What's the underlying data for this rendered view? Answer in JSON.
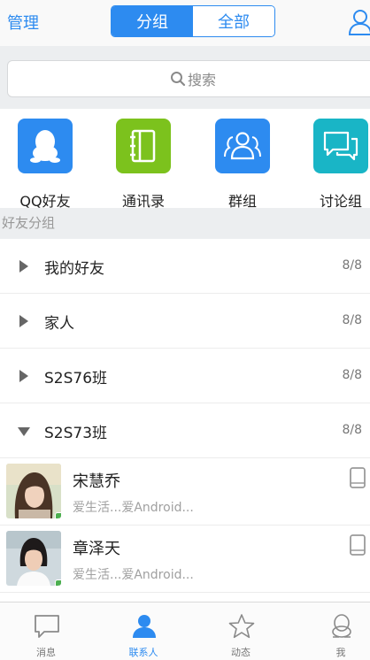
{
  "header": {
    "manage_label": "管理",
    "segments": [
      {
        "label": "分组",
        "active": true
      },
      {
        "label": "全部",
        "active": false
      }
    ]
  },
  "search": {
    "placeholder": "搜索"
  },
  "quick_entries": [
    {
      "label": "QQ好友",
      "icon": "qq-penguin-icon",
      "color": "#2d8bf0"
    },
    {
      "label": "通讯录",
      "icon": "contacts-book-icon",
      "color": "#7cc21d"
    },
    {
      "label": "群组",
      "icon": "group-people-icon",
      "color": "#2d8bf0"
    },
    {
      "label": "讨论组",
      "icon": "chat-bubbles-icon",
      "color": "#19b5c6"
    }
  ],
  "section_title": "好友分组",
  "groups": [
    {
      "name": "我的好友",
      "count": "8/8",
      "expanded": false
    },
    {
      "name": "家人",
      "count": "8/8",
      "expanded": false
    },
    {
      "name": "S2S76班",
      "count": "8/8",
      "expanded": false
    },
    {
      "name": "S2S73班",
      "count": "8/8",
      "expanded": true
    }
  ],
  "friends": [
    {
      "name": "宋慧乔",
      "signature": "爱生活...爱Android...",
      "device": "phone-icon"
    },
    {
      "name": "章泽天",
      "signature": "爱生活...爱Android...",
      "device": "phone-icon"
    }
  ],
  "tabs": [
    {
      "label": "消息",
      "icon": "message-icon",
      "active": false
    },
    {
      "label": "联系人",
      "icon": "contacts-icon",
      "active": true
    },
    {
      "label": "动态",
      "icon": "star-icon",
      "active": false
    },
    {
      "label": "我",
      "icon": "qq-penguin-icon",
      "active": false
    }
  ],
  "colors": {
    "accent": "#2d8bf0",
    "online_badge": "#4caf50"
  }
}
